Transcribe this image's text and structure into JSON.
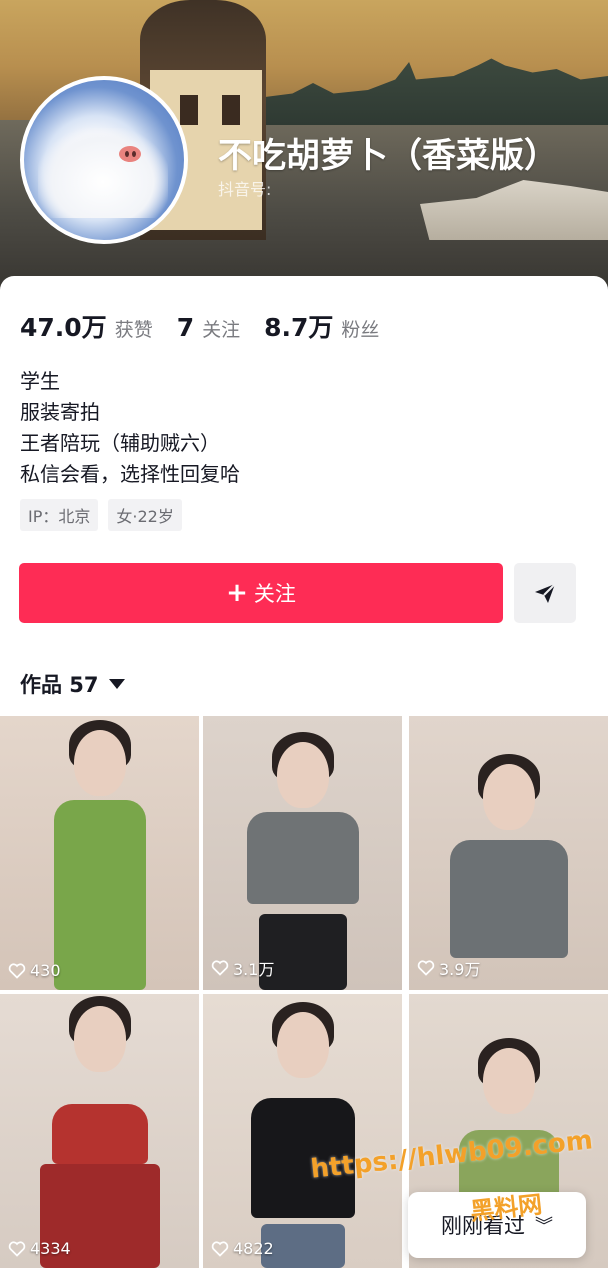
{
  "profile": {
    "nickname": "不吃胡萝卜（香菜版）",
    "douyin_id_label": "抖音号:",
    "avatar_icon": "pig-cloud-avatar"
  },
  "stats": [
    {
      "value": "47.0万",
      "label": "获赞"
    },
    {
      "value": "7",
      "label": "关注"
    },
    {
      "value": "8.7万",
      "label": "粉丝"
    }
  ],
  "bio": [
    "学生",
    "服装寄拍",
    "王者陪玩（辅助贼六）",
    "私信会看，选择性回复哈"
  ],
  "tags": [
    "IP：北京",
    "女·22岁"
  ],
  "actions": {
    "follow_label": "关注",
    "follow_icon": "plus-icon",
    "share_icon": "send-icon",
    "accent_color": "#fe2c55"
  },
  "works": {
    "tab_label": "作品 57",
    "items": [
      {
        "likes": "430",
        "outfit": "green dress"
      },
      {
        "likes": "3.1万",
        "outfit": "grey crop top"
      },
      {
        "likes": "3.9万",
        "outfit": "grey crop top"
      },
      {
        "likes": "4334",
        "outfit": "red costume"
      },
      {
        "likes": "4822",
        "outfit": "black top"
      },
      {
        "likes": "",
        "outfit": "green top"
      }
    ]
  },
  "watermark": {
    "line1": "https://hlwb09.com",
    "line2": "黑料网"
  },
  "floating": {
    "recent_label": "刚刚看过"
  }
}
